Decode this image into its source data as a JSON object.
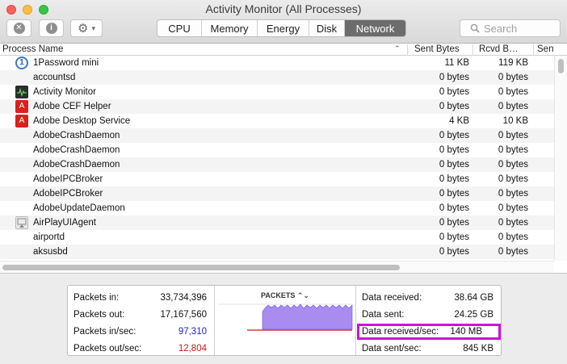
{
  "window": {
    "title": "Activity Monitor (All Processes)"
  },
  "toolbar": {
    "stop_icon": "x-circle-icon",
    "info_icon": "info-icon",
    "gear_icon": "gear-icon",
    "tabs": [
      "CPU",
      "Memory",
      "Energy",
      "Disk",
      "Network"
    ],
    "active_tab": "Network",
    "search_placeholder": "Search"
  },
  "table": {
    "columns": [
      "Process Name",
      "Sent Bytes",
      "Rcvd B…",
      "Sent"
    ],
    "rows": [
      {
        "name": "1Password mini",
        "sent": "11 KB",
        "rcvd": "119 KB",
        "icon": "onepassword-icon"
      },
      {
        "name": "accountsd",
        "sent": "0 bytes",
        "rcvd": "0 bytes",
        "icon": ""
      },
      {
        "name": "Activity Monitor",
        "sent": "0 bytes",
        "rcvd": "0 bytes",
        "icon": "activity-monitor-icon"
      },
      {
        "name": "Adobe CEF Helper",
        "sent": "0 bytes",
        "rcvd": "0 bytes",
        "icon": "adobe-icon"
      },
      {
        "name": "Adobe Desktop Service",
        "sent": "4 KB",
        "rcvd": "10 KB",
        "icon": "adobe-icon"
      },
      {
        "name": "AdobeCrashDaemon",
        "sent": "0 bytes",
        "rcvd": "0 bytes",
        "icon": ""
      },
      {
        "name": "AdobeCrashDaemon",
        "sent": "0 bytes",
        "rcvd": "0 bytes",
        "icon": ""
      },
      {
        "name": "AdobeCrashDaemon",
        "sent": "0 bytes",
        "rcvd": "0 bytes",
        "icon": ""
      },
      {
        "name": "AdobeIPCBroker",
        "sent": "0 bytes",
        "rcvd": "0 bytes",
        "icon": ""
      },
      {
        "name": "AdobeIPCBroker",
        "sent": "0 bytes",
        "rcvd": "0 bytes",
        "icon": ""
      },
      {
        "name": "AdobeUpdateDaemon",
        "sent": "0 bytes",
        "rcvd": "0 bytes",
        "icon": ""
      },
      {
        "name": "AirPlayUIAgent",
        "sent": "0 bytes",
        "rcvd": "0 bytes",
        "icon": "airplay-icon"
      },
      {
        "name": "airportd",
        "sent": "0 bytes",
        "rcvd": "0 bytes",
        "icon": ""
      },
      {
        "name": "aksusbd",
        "sent": "0 bytes",
        "rcvd": "0 bytes",
        "icon": ""
      }
    ]
  },
  "summary": {
    "packets_in_label": "Packets in:",
    "packets_in": "33,734,396",
    "packets_out_label": "Packets out:",
    "packets_out": "17,167,560",
    "packets_in_sec_label": "Packets in/sec:",
    "packets_in_sec": "97,310",
    "packets_out_sec_label": "Packets out/sec:",
    "packets_out_sec": "12,804",
    "graph_title": "PACKETS",
    "graph_toggle_icon": "up-down-chevron-icon",
    "data_received_label": "Data received:",
    "data_received": "38.64 GB",
    "data_sent_label": "Data sent:",
    "data_sent": "24.25 GB",
    "data_received_sec_label": "Data received/sec:",
    "data_received_sec": "140 MB",
    "data_sent_sec_label": "Data sent/sec:",
    "data_sent_sec": "845 KB"
  },
  "colors": {
    "packets_in_series": "#2020d8",
    "packets_out_series": "#d01818",
    "graph_fill": "#a88cf0",
    "highlight_box": "#cc13d6"
  }
}
